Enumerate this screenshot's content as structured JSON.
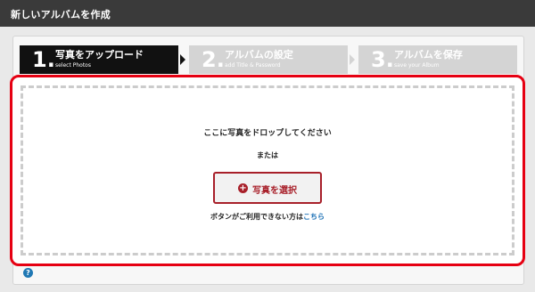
{
  "header": {
    "title": "新しいアルバムを作成"
  },
  "steps": [
    {
      "number": "1.",
      "label": "写真をアップロード",
      "sub": "select Photos",
      "active": true
    },
    {
      "number": "2.",
      "label": "アルバムの設定",
      "sub": "add Title & Password",
      "active": false
    },
    {
      "number": "3.",
      "label": "アルバムを保存",
      "sub": "save your Album",
      "active": false
    }
  ],
  "dropzone": {
    "prompt": "ここに写真をドロップしてください",
    "or": "または",
    "select_button": {
      "icon": "plus-circle-icon",
      "label": "写真を選択"
    },
    "fallback_text": "ボタンがご利用できない方は",
    "fallback_link": "こちら"
  },
  "help": {
    "icon": "question-icon",
    "symbol": "?"
  },
  "colors": {
    "accent": "#e60012",
    "button": "#a8202a",
    "link": "#1a6fb5",
    "header": "#3a3a3a"
  }
}
